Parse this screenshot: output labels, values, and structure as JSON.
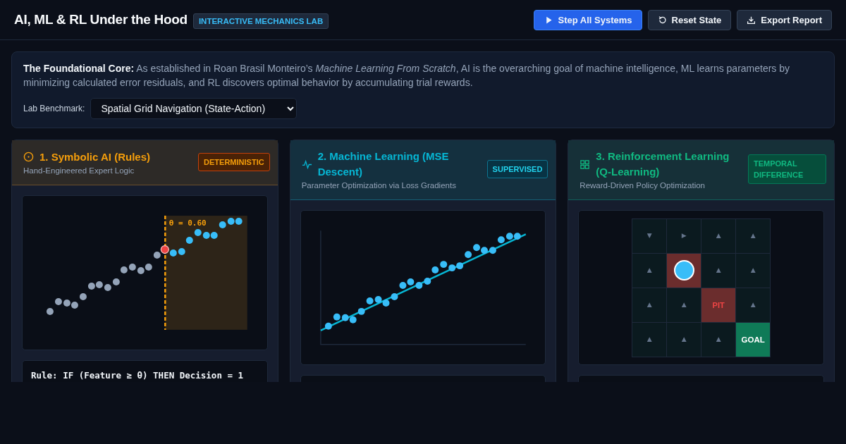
{
  "header": {
    "title": "AI, ML & RL Under the Hood",
    "badge": "INTERACTIVE MECHANICS LAB",
    "buttons": [
      {
        "label": "Step All Systems",
        "kind": "primary"
      },
      {
        "label": "Reset State",
        "kind": "secondary"
      },
      {
        "label": "Export Report",
        "kind": "secondary"
      }
    ]
  },
  "intro": {
    "text": "**The Foundational Core:** As established in Roan Brasil Monteiro’s *Machine Learning From Scratch*, AI is the overarching goal of machine intelligence, ML learns parameters by minimizing calculated error residuals, and RL discovers optimal behavior by accumulating trial rewards.",
    "benchmark_label": "Lab Benchmark:",
    "benchmark_value": "Spatial Grid Navigation (State-Action)"
  },
  "panels": [
    {
      "kind": "symbolic",
      "title": "1. Symbolic AI (Rules)",
      "subtitle": "Hand-Engineered Expert Logic",
      "tag": "DETERMINISTIC",
      "threshold_label": "θ = 0.60",
      "rule": "Rule: IF (Feature ≥ θ) THEN Decision = 1"
    },
    {
      "kind": "ml",
      "title": "2. Machine Learning (MSE Descent)",
      "subtitle": "Parameter Optimization via Loss Gradients",
      "tag": "SUPERVISED"
    },
    {
      "kind": "rl",
      "title": "3. Reinforcement Learning (Q-Learning)",
      "subtitle": "Reward-Driven Policy Optimization",
      "tag": "TEMPORAL DIFFERENCE",
      "grid": [
        {
          "kind": "arrow",
          "label": "▼"
        },
        {
          "kind": "arrow",
          "label": "▶"
        },
        {
          "kind": "arrow",
          "label": "▲"
        },
        {
          "kind": "arrow",
          "label": "▲"
        },
        {
          "kind": "arrow",
          "label": "▲"
        },
        {
          "kind": "agent"
        },
        {
          "kind": "arrow",
          "label": "▲"
        },
        {
          "kind": "arrow",
          "label": "▲"
        },
        {
          "kind": "arrow",
          "label": "▲"
        },
        {
          "kind": "arrow",
          "label": "▲"
        },
        {
          "kind": "pit",
          "label": "PIT"
        },
        {
          "kind": "arrow",
          "label": "▲"
        },
        {
          "kind": "arrow",
          "label": "▲"
        },
        {
          "kind": "arrow",
          "label": "▲"
        },
        {
          "kind": "arrow",
          "label": "▲"
        },
        {
          "kind": "goal",
          "label": "GOAL"
        }
      ]
    }
  ]
}
